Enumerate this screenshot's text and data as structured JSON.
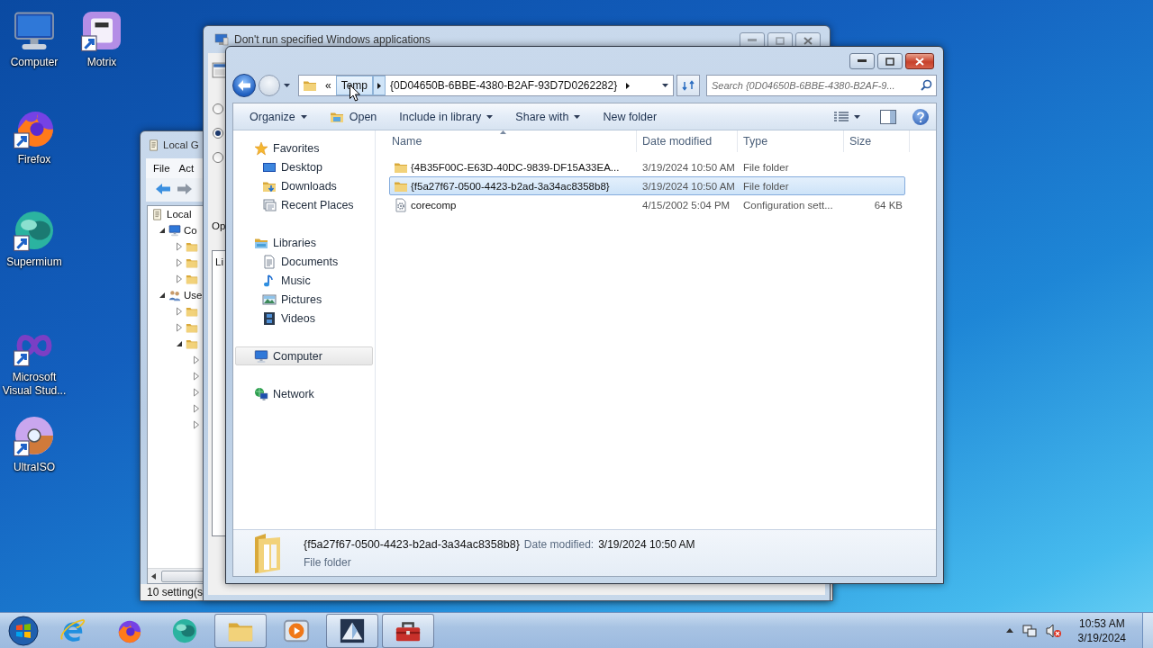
{
  "desktop_icons": [
    {
      "label": "Computer",
      "kind": "computer",
      "shortcut": false
    },
    {
      "label": "Motrix",
      "kind": "motrix",
      "shortcut": true
    },
    {
      "label": "Firefox",
      "kind": "firefox",
      "shortcut": true
    },
    {
      "label": "Supermium",
      "kind": "supermium",
      "shortcut": true
    },
    {
      "label": "Microsoft Visual Stud...",
      "kind": "vs",
      "shortcut": true
    },
    {
      "label": "UltraISO",
      "kind": "ultraiso",
      "shortcut": true
    }
  ],
  "policy_editor": {
    "title": "Local G",
    "menu": [
      "File",
      "Act"
    ],
    "tree": [
      {
        "label": "Local",
        "children": [
          {
            "label": "Co",
            "kind": "computer",
            "expanded": true,
            "children": [
              {
                "expanded": false
              },
              {
                "expanded": false
              },
              {
                "expanded": false
              }
            ]
          },
          {
            "label": "Use",
            "kind": "users",
            "expanded": true,
            "children": [
              {
                "expanded": false
              },
              {
                "expanded": false
              },
              {
                "expanded": true,
                "children": [
                  {
                    "expanded": false
                  },
                  {
                    "expanded": false
                  },
                  {
                    "expanded": false
                  },
                  {
                    "expanded": false
                  },
                  {
                    "expanded": false
                  }
                ]
              }
            ]
          }
        ]
      }
    ],
    "status": "10 setting(s"
  },
  "policy_dialog": {
    "title": "Don't run specified Windows applications",
    "options": [
      {
        "selected": false
      },
      {
        "selected": true
      },
      {
        "selected": false
      }
    ],
    "section_label": "Op",
    "list_label": "Li"
  },
  "explorer": {
    "breadcrumb_overflow": "«",
    "breadcrumb": [
      "Temp",
      "{0D04650B-6BBE-4380-B2AF-93D7D0262282}"
    ],
    "search": {
      "placeholder": "Search {0D04650B-6BBE-4380-B2AF-9..."
    },
    "toolbar": [
      {
        "label": "Organize",
        "kind": "menu"
      },
      {
        "label": "Open",
        "kind": "open"
      },
      {
        "label": "Include in library",
        "kind": "menu"
      },
      {
        "label": "Share with",
        "kind": "menu"
      },
      {
        "label": "New folder",
        "kind": "plain"
      }
    ],
    "navigation": [
      {
        "label": "Favorites",
        "kind": "star",
        "selected": false,
        "children": [
          {
            "label": "Desktop",
            "kind": "desktop",
            "selected": false
          },
          {
            "label": "Downloads",
            "kind": "downloads",
            "selected": false
          },
          {
            "label": "Recent Places",
            "kind": "recent",
            "selected": false
          }
        ]
      },
      {
        "label": "Libraries",
        "kind": "library",
        "selected": false,
        "children": [
          {
            "label": "Documents",
            "kind": "documents",
            "selected": false
          },
          {
            "label": "Music",
            "kind": "music",
            "selected": false
          },
          {
            "label": "Pictures",
            "kind": "pictures",
            "selected": false
          },
          {
            "label": "Videos",
            "kind": "videos",
            "selected": false
          }
        ]
      },
      {
        "label": "Computer",
        "kind": "computer",
        "selected": true
      },
      {
        "label": "Network",
        "kind": "network",
        "selected": false
      }
    ],
    "columns": [
      "Name",
      "Date modified",
      "Type",
      "Size"
    ],
    "rows": [
      {
        "name": "{4B35F00C-E63D-40DC-9839-DF15A33EA...",
        "date": "3/19/2024 10:50 AM",
        "type": "File folder",
        "kind": "folder",
        "selected": false
      },
      {
        "name": "{f5a27f67-0500-4423-b2ad-3a34ac8358b8}",
        "date": "3/19/2024 10:50 AM",
        "type": "File folder",
        "kind": "folder",
        "selected": true
      },
      {
        "name": "corecomp",
        "date": "4/15/2002 5:04 PM",
        "type": "Configuration sett...",
        "size": "64 KB",
        "kind": "config",
        "selected": false
      }
    ],
    "details": {
      "name": "{f5a27f67-0500-4423-b2ad-3a34ac8358b8}",
      "date_label": "Date modified:",
      "date": "3/19/2024 10:50 AM",
      "type": "File folder"
    }
  },
  "taskbar": {
    "items": [
      {
        "kind": "ie",
        "open": false
      },
      {
        "kind": "firefox",
        "open": false
      },
      {
        "kind": "supermium",
        "open": false
      },
      {
        "kind": "folder",
        "open": true
      },
      {
        "kind": "media",
        "open": false
      },
      {
        "kind": "mountain",
        "open": true
      },
      {
        "kind": "toolbox",
        "open": true
      }
    ],
    "time": "10:53 AM",
    "date": "3/19/2024"
  }
}
